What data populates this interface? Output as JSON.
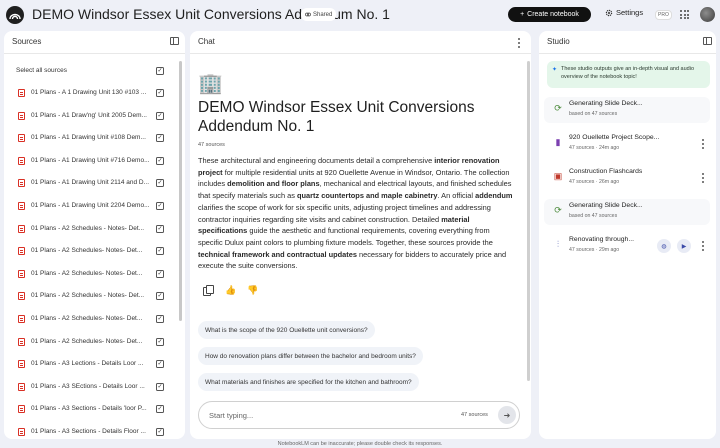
{
  "header": {
    "title": "DEMO Windsor Essex Unit Conversions Addendum No. 1",
    "shared_label": "Shared",
    "create_label": "Create notebook",
    "settings_label": "Settings",
    "pro_label": "PRO"
  },
  "sources": {
    "heading": "Sources",
    "select_all": "Select all sources",
    "items": [
      {
        "label": "01 Plans - A 1 Drawing Unit 130 #103 ..."
      },
      {
        "label": "01 Plans - A1 Draw'ng' Unit 2005 Dem..."
      },
      {
        "label": "01 Plans - A1 Drawing Unit #108 Dem..."
      },
      {
        "label": "01 Plans - A1 Drawing Unit #716 Demo..."
      },
      {
        "label": "01 Plans - A1 Drawing Unit 2114 and D..."
      },
      {
        "label": "01 Plans - A1 Drawing Unit 2204 Demo..."
      },
      {
        "label": "01 Plans - A2 Schedules - Notes- Det..."
      },
      {
        "label": "01 Plans - A2 Schedules- Notes- Det..."
      },
      {
        "label": "01 Plans - A2 Schedules- Notes- Det..."
      },
      {
        "label": "01 Plans - A2 Schedules - Notes- Det..."
      },
      {
        "label": "01 Plans - A2 Schedules- Notes- Det..."
      },
      {
        "label": "01 Plans - A2 Schedules- Notes- Det..."
      },
      {
        "label": "01 Plans - A3 Lections - Details Loor ..."
      },
      {
        "label": "01 Plans - A3 SEctions - Details Loor ..."
      },
      {
        "label": "01 Plans - A3 Sections - Details 'loor P..."
      },
      {
        "label": "01 Plans - A3 Sections - Details Floor ..."
      }
    ]
  },
  "chat": {
    "heading": "Chat",
    "emoji": "🏢",
    "title": "DEMO Windsor Essex Unit Conversions Addendum No. 1",
    "source_count": "47 sources",
    "summary": [
      {
        "t": "These architectural and engineering documents detail a comprehensive ",
        "b": false
      },
      {
        "t": "interior renovation project",
        "b": true
      },
      {
        "t": " for multiple residential units at 920 Ouellette Avenue in Windsor, Ontario. The collection includes ",
        "b": false
      },
      {
        "t": "demolition and floor plans",
        "b": true
      },
      {
        "t": ", mechanical and electrical layouts, and finished schedules that specify materials such as ",
        "b": false
      },
      {
        "t": "quartz countertops and maple cabinetry",
        "b": true
      },
      {
        "t": ". An official ",
        "b": false
      },
      {
        "t": "addendum",
        "b": true
      },
      {
        "t": " clarifies the scope of work for six specific units, adjusting project timelines and addressing contractor inquiries regarding site visits and cabinet construction. Detailed ",
        "b": false
      },
      {
        "t": "material specifications",
        "b": true
      },
      {
        "t": " guide the aesthetic and functional requirements, covering everything from specific Dulux paint colors to plumbing fixture models. Together, these sources provide the ",
        "b": false
      },
      {
        "t": "technical framework and contractual updates",
        "b": true
      },
      {
        "t": " necessary for bidders to accurately price and execute the suite conversions.",
        "b": false
      }
    ],
    "suggestions": [
      "What is the scope of the 920 Ouellette unit conversions?",
      "How do renovation plans differ between the bachelor and bedroom units?",
      "What materials and finishes are specified for the kitchen and bathroom?"
    ],
    "input_placeholder": "Start typing...",
    "input_count": "47 sources"
  },
  "studio": {
    "heading": "Studio",
    "note": "These studio outputs give an in-depth visual and audio overview of the notebook topic!",
    "items": [
      {
        "title": "Generating Slide Deck...",
        "sub": "based on 47 sources",
        "icon": "sync-icon",
        "generating": true
      },
      {
        "title": "920 Ouellette Project Scope...",
        "sub": "47 sources · 24m ago",
        "icon": "chart-icon",
        "generating": false
      },
      {
        "title": "Construction Flashcards",
        "sub": "47 sources · 26m ago",
        "icon": "flashcards-icon",
        "generating": false
      },
      {
        "title": "Generating Slide Deck...",
        "sub": "based on 47 sources",
        "icon": "sync-icon",
        "generating": true
      },
      {
        "title": "Renovating through...",
        "sub": "47 sources · 29m ago",
        "icon": "audio-wave-icon",
        "generating": false
      }
    ]
  },
  "footer": "NotebookLM can be inaccurate; please double check its responses.",
  "colors": {
    "background": "#eef0f7",
    "accent": "#1f1f1f",
    "pdf_icon": "#d93025",
    "generating": "#4a8a3a",
    "chart": "#7b3fb0",
    "flashcards": "#c0392b",
    "audio": "#3c4ba8",
    "note_bg": "#e4f6ea"
  }
}
